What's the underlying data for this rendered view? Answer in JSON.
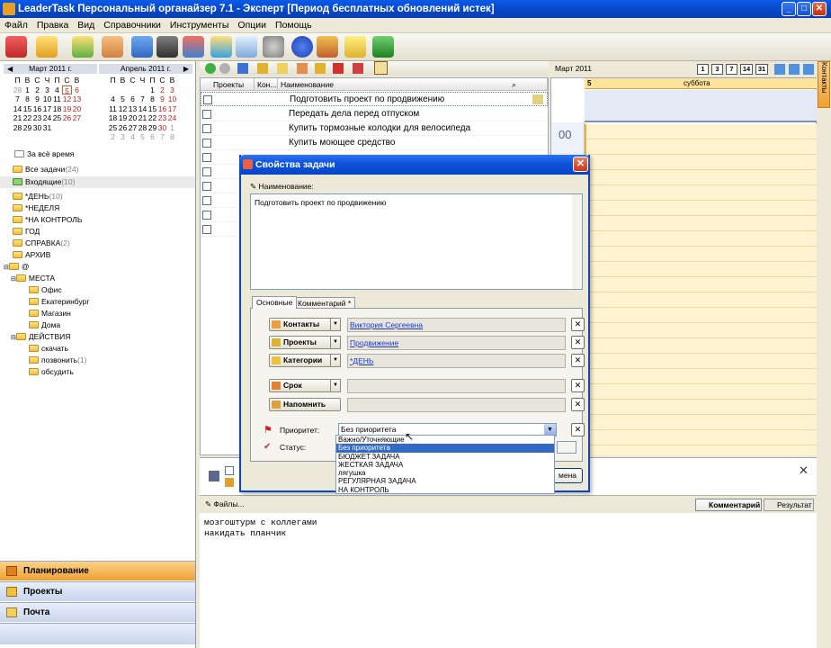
{
  "title": "LeaderTask Персональный органайзер 7.1 - Эксперт [Период бесплатных обновлений истек]",
  "menu": [
    "Файл",
    "Правка",
    "Вид",
    "Справочники",
    "Инструменты",
    "Опции",
    "Помощь"
  ],
  "cal1": {
    "title": "Март 2011 г.",
    "dow": [
      "П",
      "В",
      "С",
      "Ч",
      "П",
      "С",
      "В"
    ],
    "days": [
      "28",
      "1",
      "2",
      "3",
      "4",
      "5",
      "6",
      "7",
      "8",
      "9",
      "10",
      "11",
      "12",
      "13",
      "14",
      "15",
      "16",
      "17",
      "18",
      "19",
      "20",
      "21",
      "22",
      "23",
      "24",
      "25",
      "26",
      "27",
      "28",
      "29",
      "30",
      "31"
    ]
  },
  "cal2": {
    "title": "Апрель 2011 г.",
    "dow": [
      "П",
      "В",
      "С",
      "Ч",
      "П",
      "С",
      "В"
    ],
    "days": [
      "1",
      "2",
      "3",
      "4",
      "5",
      "6",
      "7",
      "8",
      "9",
      "10",
      "11",
      "12",
      "13",
      "14",
      "15",
      "16",
      "17",
      "18",
      "19",
      "20",
      "21",
      "22",
      "23",
      "24",
      "25",
      "26",
      "27",
      "28",
      "29",
      "30",
      "1",
      "2",
      "3",
      "4",
      "5",
      "6",
      "7",
      "8"
    ]
  },
  "tree": {
    "all_time": "За всё время",
    "all_tasks": "Все задачи",
    "all_tasks_count": "(24)",
    "inbox": "Входящие",
    "inbox_count": "(10)",
    "day": "*ДЕНЬ",
    "day_count": "(10)",
    "week": "*НЕДЕЛЯ",
    "control": "*НА КОНТРОЛЬ",
    "year": "ГОД",
    "help": "СПРАВКА",
    "help_count": "(2)",
    "archive": "АРХИВ",
    "at": "@",
    "places": "МЕСТА",
    "office": "Офис",
    "ekb": "Екатеринбург",
    "shop": "Магазин",
    "home": "Дома",
    "actions": "ДЕЙСТВИЯ",
    "download": "скачать",
    "call": "позвонить",
    "call_count": "(1)",
    "discuss": "обсудить"
  },
  "bottom_tabs": [
    "Планирование",
    "Проекты",
    "Почта"
  ],
  "columns": [
    "Проекты",
    "Кон...",
    "Наименование"
  ],
  "tasks": [
    "Подготовить проект по продвижению",
    "Передать дела перед отпуском",
    "Купить тормозные колодки для велосипеда",
    "Купить моющее средство"
  ],
  "calendar_panel": {
    "month": "Март 2011",
    "day_num": "5",
    "day_name": "суббота",
    "time": "00",
    "view_buttons": [
      "1",
      "3",
      "7",
      "14",
      "31"
    ]
  },
  "dialog": {
    "title": "Свойства задачи",
    "name_label": "Наименование:",
    "name_value": "Подготовить проект по продвижению",
    "tabs": [
      "Основные",
      "Комментарий *"
    ],
    "contacts_label": "Контакты",
    "contacts_value": "Виктория Сергеевна",
    "projects_label": "Проекты",
    "projects_value": "Продвижение",
    "categories_label": "Категории",
    "categories_value": "*ДЕНЬ",
    "deadline_label": "Срок",
    "remind_label": "Напомнить",
    "priority_label": "Приоритет:",
    "priority_value": "Без приоритета",
    "status_label": "Статус:",
    "cancel_label": "мена",
    "priority_options": [
      "Важно/Уточняющие",
      "Без приоритета",
      "БЮДЖЕТ.ЗАДАЧА",
      "ЖЕСТКАЯ ЗАДАЧА",
      "лягушка",
      "РЕГУЛЯРНАЯ ЗАДАЧА",
      "НА КОНТРОЛЬ"
    ]
  },
  "bottom": {
    "files_label": "Файлы...",
    "comment_tab": "Комментарий",
    "result_tab": "Результат",
    "comment_text": [
      "мозгоштурм с коллегами",
      "накидать планчик"
    ]
  },
  "right_strip_label": "Контакты"
}
